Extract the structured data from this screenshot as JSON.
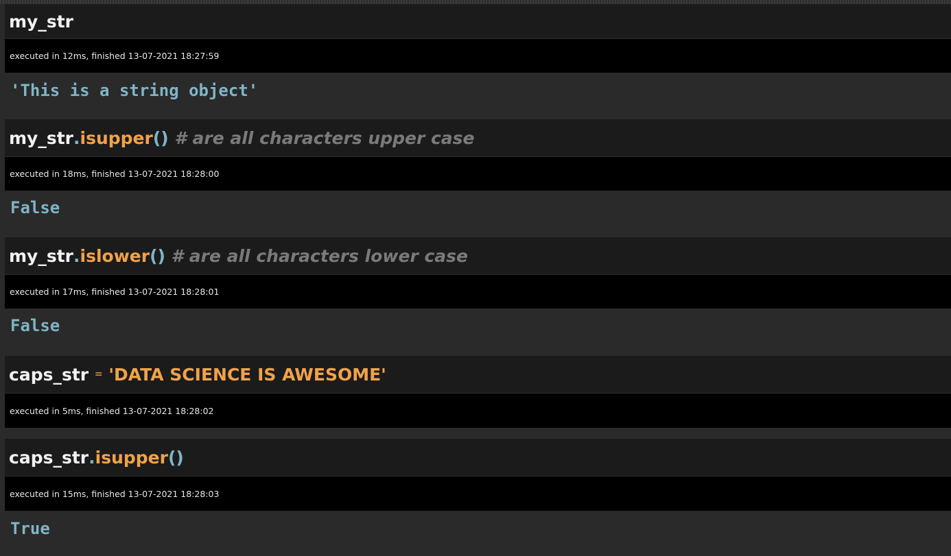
{
  "cells": [
    {
      "input": {
        "var": "my_str"
      },
      "meta": "executed in 12ms, finished 13-07-2021 18:27:59",
      "output": "'This is a string object'"
    },
    {
      "input": {
        "var": "my_str",
        "dot": ".",
        "method": "isupper",
        "parens": "()",
        "comment": " # are all characters upper case"
      },
      "meta": "executed in 18ms, finished 13-07-2021 18:28:00",
      "output": "False"
    },
    {
      "input": {
        "var": "my_str",
        "dot": ".",
        "method": "islower",
        "parens": "()",
        "comment": " # are all characters lower case"
      },
      "meta": "executed in 17ms, finished 13-07-2021 18:28:01",
      "output": "False"
    },
    {
      "input": {
        "var": "caps_str",
        "op": "=",
        "string": "'DATA SCIENCE IS AWESOME'"
      },
      "meta": "executed in 5ms, finished 13-07-2021 18:28:02"
    },
    {
      "input": {
        "var": "caps_str",
        "dot": ".",
        "method": "isupper",
        "parens": "()"
      },
      "meta": "executed in 15ms, finished 13-07-2021 18:28:03",
      "output": "True"
    }
  ],
  "colors": {
    "page_bg": "#2a2a2a",
    "input_bg": "#1b1b1b",
    "meta_bg": "#000000",
    "variable": "#f2f2f2",
    "method": "#f0a24a",
    "punctuation": "#7fb5c6",
    "comment": "#7a7a7a",
    "output": "#7fb5c6"
  }
}
